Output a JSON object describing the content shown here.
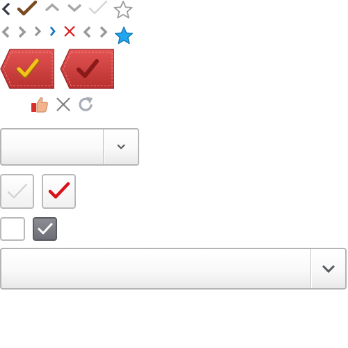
{
  "icons": {
    "row1": [
      "chevron-left-icon",
      "checkmark-brown-icon",
      "chevron-up-icon",
      "chevron-down-icon",
      "checkmark-light-icon",
      "star-outline-icon"
    ],
    "row2": [
      "chevron-left-gray-icon",
      "chevron-right-gray-icon",
      "chevron-right-small-icon",
      "chevron-right-blue-icon",
      "close-red-icon",
      "chevron-left-right-icon",
      "star-blue-icon"
    ],
    "row3": [
      "tag-check-yellow-icon",
      "tag-check-dark-icon"
    ],
    "row4": [
      "thumbs-up-icon",
      "close-gray-icon",
      "refresh-icon"
    ]
  },
  "colors": {
    "tag_red": "#cc3b3a",
    "tag_red_dark": "#a52524",
    "check_yellow": "#f4c21c",
    "check_red": "#d8121a",
    "star_blue": "#21a6f0",
    "chevron_blue": "#1a7bc0",
    "close_red": "#d81b1b",
    "border_gray": "#b4b4b4",
    "checkbox_checked_bg": "#7d7d86"
  },
  "select_small": {
    "value": ""
  },
  "select_large": {
    "value": ""
  },
  "checkboxes": {
    "large": [
      {
        "checked": false
      },
      {
        "checked": true
      }
    ],
    "small": [
      {
        "checked": false
      },
      {
        "checked": true
      }
    ]
  }
}
